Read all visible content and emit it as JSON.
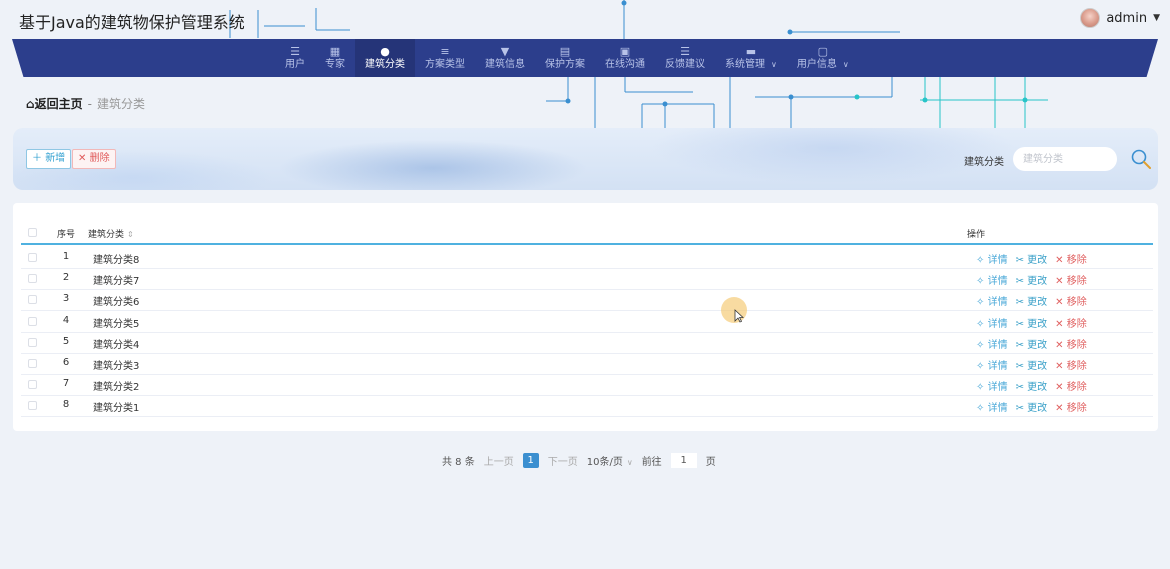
{
  "header": {
    "title": "基于Java的建筑物保护管理系统",
    "username": "admin"
  },
  "nav": {
    "items": [
      {
        "label": "用户",
        "icon": "menu-icon"
      },
      {
        "label": "专家",
        "icon": "grid-icon"
      },
      {
        "label": "建筑分类",
        "icon": "user-icon",
        "active": true
      },
      {
        "label": "方案类型",
        "icon": "sliders-icon"
      },
      {
        "label": "建筑信息",
        "icon": "pin-icon"
      },
      {
        "label": "保护方案",
        "icon": "clipboard-icon"
      },
      {
        "label": "在线沟通",
        "icon": "building-icon"
      },
      {
        "label": "反馈建议",
        "icon": "list-icon"
      },
      {
        "label": "系统管理",
        "icon": "server-icon",
        "dropdown": true
      },
      {
        "label": "用户信息",
        "icon": "window-icon",
        "dropdown": true
      }
    ]
  },
  "breadcrumb": {
    "home": "返回主页",
    "separator": "-",
    "current": "建筑分类"
  },
  "toolbar": {
    "add_label": "新增",
    "delete_label": "删除",
    "search_label": "建筑分类",
    "search_placeholder": "建筑分类"
  },
  "table": {
    "headers": {
      "no": "序号",
      "name": "建筑分类",
      "op": "操作"
    },
    "actions": {
      "detail": "详情",
      "edit": "更改",
      "remove": "移除"
    },
    "rows": [
      {
        "no": "1",
        "name": "建筑分类8"
      },
      {
        "no": "2",
        "name": "建筑分类7"
      },
      {
        "no": "3",
        "name": "建筑分类6"
      },
      {
        "no": "4",
        "name": "建筑分类5"
      },
      {
        "no": "5",
        "name": "建筑分类4"
      },
      {
        "no": "6",
        "name": "建筑分类3"
      },
      {
        "no": "7",
        "name": "建筑分类2"
      },
      {
        "no": "8",
        "name": "建筑分类1"
      }
    ]
  },
  "pagination": {
    "total": "共 8 条",
    "prev": "上一页",
    "current": "1",
    "next": "下一页",
    "page_size": "10条/页",
    "goto_prefix": "前往",
    "goto_value": "1",
    "goto_suffix": "页"
  },
  "colors": {
    "nav_bg": "#2c3e8c",
    "nav_active": "#253478",
    "accent": "#4fb1e0",
    "danger": "#e06060"
  }
}
